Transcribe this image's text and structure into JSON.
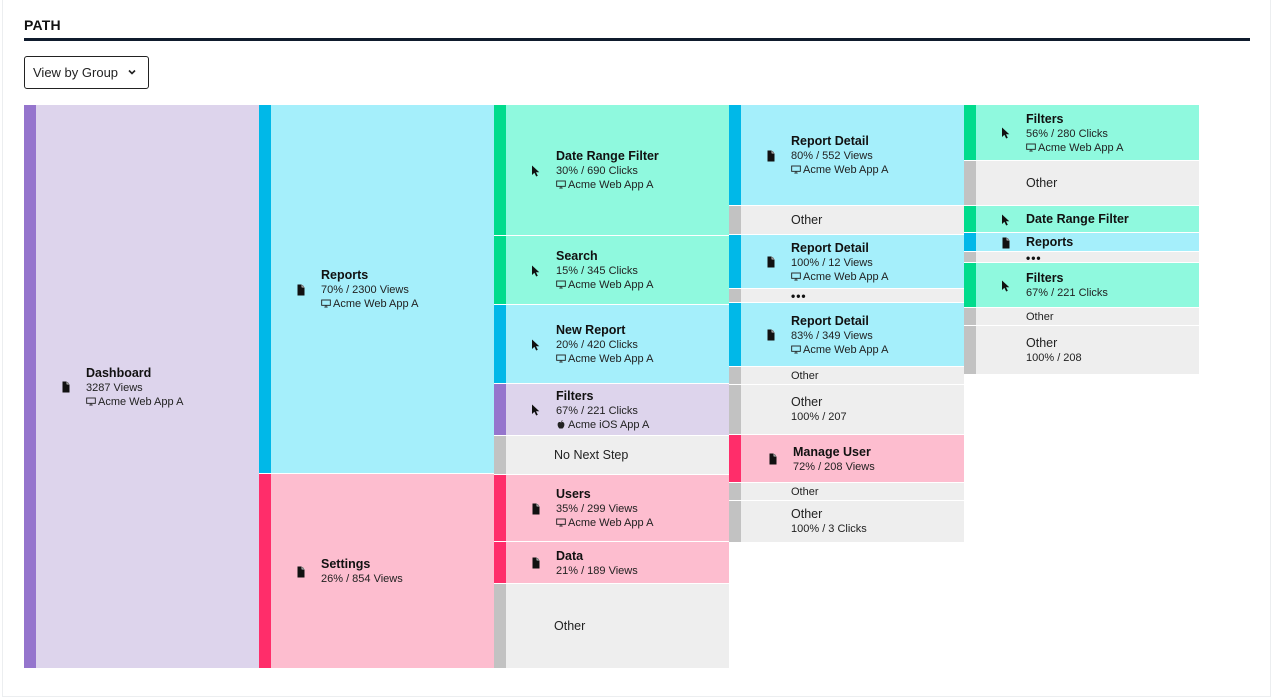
{
  "header": {
    "title": "PATH"
  },
  "controls": {
    "view_by": "View by Group"
  },
  "colors": {
    "purple": "#9575cd",
    "purple_bg": "#ddd4ec",
    "blue": "#00b8e8",
    "blue_bg": "#a5effb",
    "green": "#00dc8c",
    "green_bg": "#8ff9de",
    "pink": "#ff2d6a",
    "pink_bg": "#fdbdcf",
    "gray": "#c2c2c2",
    "gray_bg": "#eeeeee"
  },
  "columns": [
    {
      "nodes": [
        {
          "label": "Dashboard",
          "stat": "3287 Views",
          "app": "Acme Web App A",
          "app_icon": "desktop-icon",
          "icon": "document-icon",
          "color": "purple"
        }
      ]
    },
    {
      "nodes": [
        {
          "label": "Reports",
          "stat": "70% / 2300 Views",
          "app": "Acme Web App A",
          "app_icon": "desktop-icon",
          "icon": "document-icon",
          "color": "blue"
        },
        {
          "label": "Settings",
          "stat": "26% / 854 Views",
          "icon": "document-icon",
          "color": "pink"
        }
      ]
    },
    {
      "nodes": [
        {
          "label": "Date Range Filter",
          "stat": "30% / 690 Clicks",
          "app": "Acme Web App A",
          "app_icon": "desktop-icon",
          "icon": "cursor-icon",
          "color": "green"
        },
        {
          "label": "Search",
          "stat": "15% / 345 Clicks",
          "app": "Acme Web App A",
          "app_icon": "desktop-icon",
          "icon": "cursor-icon",
          "color": "green"
        },
        {
          "label": "New Report",
          "stat": "20% / 420 Clicks",
          "app": "Acme Web App A",
          "app_icon": "desktop-icon",
          "icon": "cursor-icon",
          "color": "blue"
        },
        {
          "label": "Filters",
          "stat": "67% / 221 Clicks",
          "app": "Acme iOS App A",
          "app_icon": "apple-icon",
          "icon": "cursor-icon",
          "color": "purple"
        },
        {
          "label": "No Next Step",
          "color": "gray"
        },
        {
          "label": "Users",
          "stat": "35% / 299 Views",
          "app": "Acme Web App A",
          "app_icon": "desktop-icon",
          "icon": "document-icon",
          "color": "pink"
        },
        {
          "label": "Data",
          "stat": "21% / 189 Views",
          "icon": "document-icon",
          "color": "pink"
        },
        {
          "label": "Other",
          "color": "gray"
        }
      ]
    },
    {
      "nodes": [
        {
          "label": "Report Detail",
          "stat": "80% / 552 Views",
          "app": "Acme Web App A",
          "app_icon": "desktop-icon",
          "icon": "document-icon",
          "color": "blue"
        },
        {
          "label": "Other",
          "color": "gray"
        },
        {
          "label": "Report Detail",
          "stat": "100% / 12 Views",
          "app": "Acme Web App A",
          "app_icon": "desktop-icon",
          "icon": "document-icon",
          "color": "blue"
        },
        {
          "label": "•••",
          "color": "gray"
        },
        {
          "label": "Report Detail",
          "stat": "83% / 349 Views",
          "app": "Acme Web App A",
          "app_icon": "desktop-icon",
          "icon": "document-icon",
          "color": "blue"
        },
        {
          "label": "Other",
          "color": "gray"
        },
        {
          "label": "Other",
          "stat": "100% / 207",
          "color": "gray"
        },
        {
          "label": "Manage User",
          "stat": "72% / 208 Views",
          "icon": "document-icon",
          "color": "pink"
        },
        {
          "label": "Other",
          "color": "gray"
        },
        {
          "label": "Other",
          "stat": "100% / 3 Clicks",
          "color": "gray"
        }
      ]
    },
    {
      "nodes": [
        {
          "label": "Filters",
          "stat": "56% / 280 Clicks",
          "app": "Acme Web App A",
          "app_icon": "desktop-icon",
          "icon": "cursor-icon",
          "color": "green"
        },
        {
          "label": "Other",
          "color": "gray"
        },
        {
          "label": "Date Range Filter",
          "icon": "cursor-icon",
          "color": "green"
        },
        {
          "label": "Reports",
          "icon": "document-icon",
          "color": "blue"
        },
        {
          "label": "•••",
          "color": "gray"
        },
        {
          "label": "Filters",
          "stat": "67% / 221 Clicks",
          "icon": "cursor-icon",
          "color": "green"
        },
        {
          "label": "Other",
          "color": "gray"
        },
        {
          "label": "Other",
          "stat": "100% / 208",
          "color": "gray"
        }
      ]
    }
  ]
}
